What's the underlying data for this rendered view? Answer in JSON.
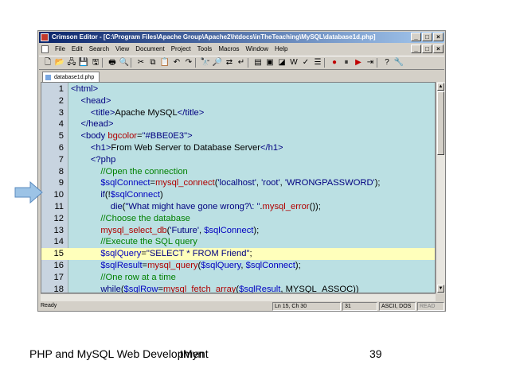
{
  "window": {
    "title": "Crimson Editor - [C:\\Program Files\\Apache Group\\Apache2\\htdocs\\inTheTeaching\\MySQL\\database1d.php]",
    "minimize": "_",
    "restore": "□",
    "close": "×"
  },
  "menu": [
    "File",
    "Edit",
    "Search",
    "View",
    "Document",
    "Project",
    "Tools",
    "Macros",
    "Window",
    "Help"
  ],
  "tab": {
    "label": "database1d.php"
  },
  "code_lines": [
    {
      "n": "1",
      "segs": [
        [
          "tag",
          "<html>"
        ]
      ]
    },
    {
      "n": "2",
      "segs": [
        [
          "k",
          "    "
        ],
        [
          "tag",
          "<head>"
        ]
      ]
    },
    {
      "n": "3",
      "segs": [
        [
          "k",
          "        "
        ],
        [
          "tag",
          "<title>"
        ],
        [
          "k",
          "Apache MySQL"
        ],
        [
          "tag",
          "</title>"
        ]
      ]
    },
    {
      "n": "4",
      "segs": [
        [
          "k",
          "    "
        ],
        [
          "tag",
          "</head>"
        ]
      ]
    },
    {
      "n": "5",
      "segs": [
        [
          "k",
          "    "
        ],
        [
          "tag",
          "<body "
        ],
        [
          "fn",
          "bgcolor"
        ],
        [
          "k",
          "="
        ],
        [
          "str",
          "\"#BBE0E3\""
        ],
        [
          "tag",
          ">"
        ]
      ]
    },
    {
      "n": "6",
      "segs": [
        [
          "k",
          "        "
        ],
        [
          "tag",
          "<h1>"
        ],
        [
          "k",
          "From Web Server to Database Server"
        ],
        [
          "tag",
          "</h1>"
        ]
      ]
    },
    {
      "n": "7",
      "segs": [
        [
          "k",
          "        "
        ],
        [
          "php",
          "<?php"
        ]
      ]
    },
    {
      "n": "8",
      "segs": [
        [
          "k",
          "            "
        ],
        [
          "com",
          "//Open the connection"
        ]
      ]
    },
    {
      "n": "9",
      "segs": [
        [
          "k",
          "            "
        ],
        [
          "var",
          "$sqlConnect"
        ],
        [
          "k",
          "="
        ],
        [
          "fn",
          "mysql_connect"
        ],
        [
          "k",
          "("
        ],
        [
          "str",
          "'localhost'"
        ],
        [
          "k",
          ", "
        ],
        [
          "str",
          "'root'"
        ],
        [
          "k",
          ", "
        ],
        [
          "str",
          "'WRONGPASSWORD'"
        ],
        [
          "k",
          ");"
        ]
      ]
    },
    {
      "n": "10",
      "segs": [
        [
          "k",
          "            "
        ],
        [
          "php",
          "if"
        ],
        [
          "k",
          "(!"
        ],
        [
          "var",
          "$sqlConnect"
        ],
        [
          "k",
          ")"
        ]
      ]
    },
    {
      "n": "11",
      "segs": [
        [
          "k",
          "                "
        ],
        [
          "php",
          "die"
        ],
        [
          "k",
          "("
        ],
        [
          "str",
          "\"What might have gone wrong?\\: \""
        ],
        [
          "k",
          "."
        ],
        [
          "fn",
          "mysql_error"
        ],
        [
          "k",
          "());"
        ]
      ]
    },
    {
      "n": "12",
      "segs": [
        [
          "k",
          "            "
        ],
        [
          "com",
          "//Choose the database"
        ]
      ]
    },
    {
      "n": "13",
      "segs": [
        [
          "k",
          "            "
        ],
        [
          "fn",
          "mysql_select_db"
        ],
        [
          "k",
          "("
        ],
        [
          "str",
          "'Future'"
        ],
        [
          "k",
          ", "
        ],
        [
          "var",
          "$sqlConnect"
        ],
        [
          "k",
          ");"
        ]
      ]
    },
    {
      "n": "14",
      "segs": [
        [
          "k",
          "            "
        ],
        [
          "com",
          "//Execute the SQL query"
        ]
      ]
    },
    {
      "n": "15",
      "segs": [
        [
          "k",
          "            "
        ],
        [
          "var",
          "$sqlQuery"
        ],
        [
          "k",
          "="
        ],
        [
          "str",
          "\"SELECT * FROM Friend\""
        ],
        [
          "k",
          ";"
        ]
      ],
      "highlight": true
    },
    {
      "n": "16",
      "segs": [
        [
          "k",
          "            "
        ],
        [
          "var",
          "$sqlResult"
        ],
        [
          "k",
          "="
        ],
        [
          "fn",
          "mysql_query"
        ],
        [
          "k",
          "("
        ],
        [
          "var",
          "$sqlQuery"
        ],
        [
          "k",
          ", "
        ],
        [
          "var",
          "$sqlConnect"
        ],
        [
          "k",
          ");"
        ]
      ]
    },
    {
      "n": "17",
      "segs": [
        [
          "k",
          "            "
        ],
        [
          "com",
          "//One row at a time"
        ]
      ]
    },
    {
      "n": "18",
      "segs": [
        [
          "k",
          "            "
        ],
        [
          "php",
          "while"
        ],
        [
          "k",
          "("
        ],
        [
          "var",
          "$sqlRow"
        ],
        [
          "k",
          "="
        ],
        [
          "fn",
          "mysql_fetch_array"
        ],
        [
          "k",
          "("
        ],
        [
          "var",
          "$sqlResult"
        ],
        [
          "k",
          ", MYSQL_ASSOC))"
        ]
      ]
    }
  ],
  "status": {
    "ready": "Ready",
    "position": "Ln 15, Ch 30",
    "col": "31",
    "encoding": "ASCII, DOS",
    "mode": "READ"
  },
  "colors": {
    "editor_bg": "#BBE0E3",
    "highlight_line": "#FFFFBB",
    "arrow_fill": "#9CC3E6"
  },
  "footer": {
    "left": "PHP and MySQL Web Development",
    "middle": "tMyn",
    "page": "39"
  }
}
